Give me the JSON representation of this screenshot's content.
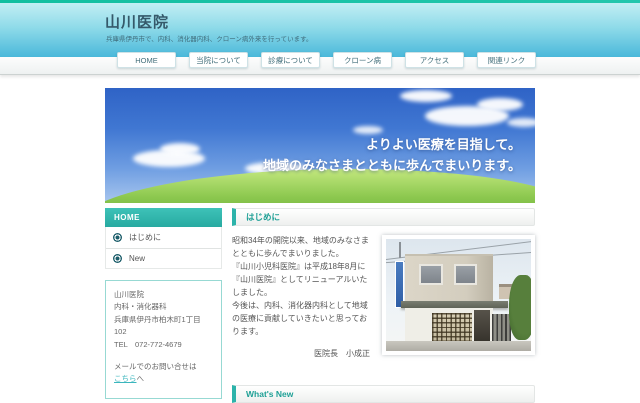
{
  "header": {
    "title": "山川医院",
    "subtitle": "兵庫県伊丹市で、内科、消化器内科、クローン病外来を行っています。"
  },
  "nav": {
    "tabs": [
      "HOME",
      "当院について",
      "診療について",
      "クローン病",
      "アクセス",
      "関連リンク"
    ]
  },
  "hero": {
    "line1": "よりよい医療を目指して。",
    "line2": "地域のみなさまとともに歩んでまいります。"
  },
  "sidebar": {
    "menu_title": "HOME",
    "menu_items": [
      "はじめに",
      "New"
    ],
    "info_lines": [
      "山川医院",
      "内科・消化器科",
      "兵庫県伊丹市柏木町1丁目102",
      "TEL　072-772-4679"
    ],
    "mail_text": "メールでのお問い合せは",
    "mail_link": "こちら",
    "mail_suffix": "へ"
  },
  "main": {
    "intro": {
      "heading": "はじめに",
      "paragraphs": [
        "昭和34年の開院以来、地域のみなさまとともに歩んでまいりました。",
        "『山川小児科医院』は平成18年8月に『山川医院』としてリニューアルいたしました。",
        "今後は、内科、消化器内科として地域の医療に貢献していきたいと思っております。"
      ],
      "signature": "医院長　小成正"
    },
    "whats_new": {
      "heading": "What's New"
    }
  },
  "colors": {
    "top_bar": "#18c0a5",
    "header_gradient_bottom": "#4ab8da",
    "accent_teal": "#2cb3aa",
    "heading_text": "#1fa096",
    "link": "#3bb6bd",
    "hero_sky": "#2f63c6",
    "hero_grass": "#8cc84f"
  }
}
